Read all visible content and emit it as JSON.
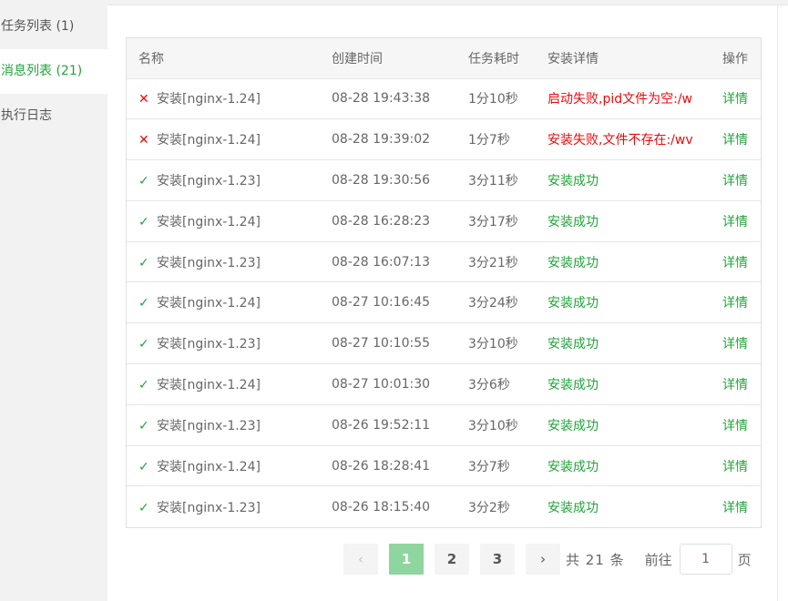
{
  "sidebar": {
    "items": [
      {
        "label": "任务列表 (1)"
      },
      {
        "label": "消息列表 (21)"
      },
      {
        "label": "执行日志"
      }
    ]
  },
  "table": {
    "headers": [
      "名称",
      "创建时间",
      "任务耗时",
      "安装详情",
      "操作"
    ],
    "rows": [
      {
        "status": "fail",
        "icon": "✕",
        "name": "安装[nginx-1.24]",
        "time": "08-28 19:43:38",
        "duration": "1分10秒",
        "detail": "启动失败,pid文件为空:/w",
        "op": "详情"
      },
      {
        "status": "fail",
        "icon": "✕",
        "name": "安装[nginx-1.24]",
        "time": "08-28 19:39:02",
        "duration": "1分7秒",
        "detail": "安装失败,文件不存在:/wv",
        "op": "详情"
      },
      {
        "status": "ok",
        "icon": "✓",
        "name": "安装[nginx-1.23]",
        "time": "08-28 19:30:56",
        "duration": "3分11秒",
        "detail": "安装成功",
        "op": "详情"
      },
      {
        "status": "ok",
        "icon": "✓",
        "name": "安装[nginx-1.24]",
        "time": "08-28 16:28:23",
        "duration": "3分17秒",
        "detail": "安装成功",
        "op": "详情"
      },
      {
        "status": "ok",
        "icon": "✓",
        "name": "安装[nginx-1.23]",
        "time": "08-28 16:07:13",
        "duration": "3分21秒",
        "detail": "安装成功",
        "op": "详情"
      },
      {
        "status": "ok",
        "icon": "✓",
        "name": "安装[nginx-1.24]",
        "time": "08-27 10:16:45",
        "duration": "3分24秒",
        "detail": "安装成功",
        "op": "详情"
      },
      {
        "status": "ok",
        "icon": "✓",
        "name": "安装[nginx-1.23]",
        "time": "08-27 10:10:55",
        "duration": "3分10秒",
        "detail": "安装成功",
        "op": "详情"
      },
      {
        "status": "ok",
        "icon": "✓",
        "name": "安装[nginx-1.24]",
        "time": "08-27 10:01:30",
        "duration": "3分6秒",
        "detail": "安装成功",
        "op": "详情"
      },
      {
        "status": "ok",
        "icon": "✓",
        "name": "安装[nginx-1.23]",
        "time": "08-26 19:52:11",
        "duration": "3分10秒",
        "detail": "安装成功",
        "op": "详情"
      },
      {
        "status": "ok",
        "icon": "✓",
        "name": "安装[nginx-1.24]",
        "time": "08-26 18:28:41",
        "duration": "3分7秒",
        "detail": "安装成功",
        "op": "详情"
      },
      {
        "status": "ok",
        "icon": "✓",
        "name": "安装[nginx-1.23]",
        "time": "08-26 18:15:40",
        "duration": "3分2秒",
        "detail": "安装成功",
        "op": "详情"
      }
    ]
  },
  "pagination": {
    "prev_icon": "‹",
    "pages": [
      "1",
      "2",
      "3"
    ],
    "current": "1",
    "next_icon": "›",
    "total_text": "共 21 条",
    "goto_label": "前往",
    "goto_value": "1",
    "page_unit": "页"
  },
  "colors": {
    "accent": "#20a53a",
    "error": "#ef0808"
  }
}
